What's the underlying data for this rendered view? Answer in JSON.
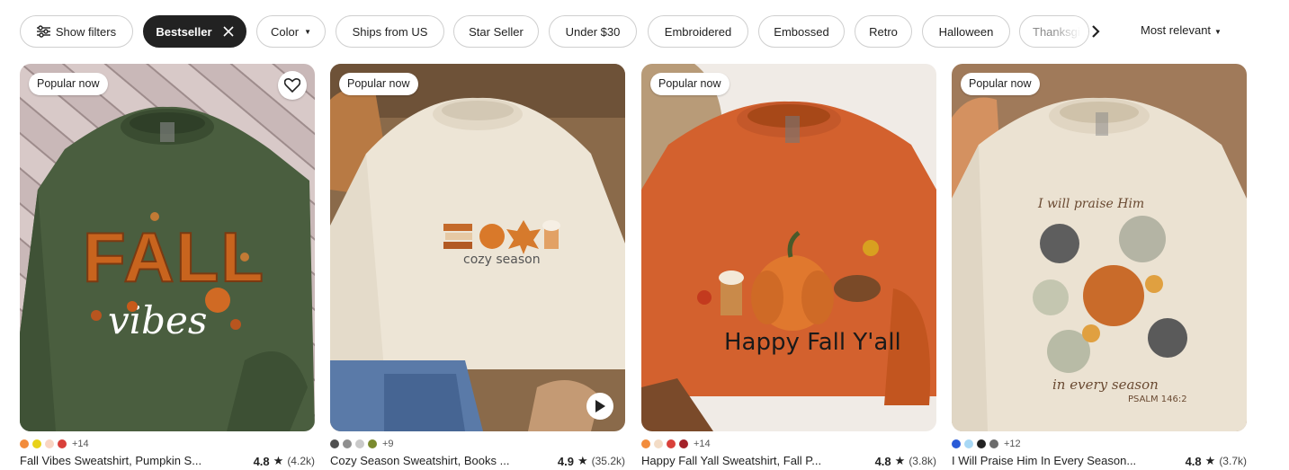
{
  "filters": {
    "show_filters": "Show filters",
    "chips": [
      "Bestseller",
      "Color",
      "Ships from US",
      "Star Seller",
      "Under $30",
      "Embroidered",
      "Embossed",
      "Retro",
      "Halloween",
      "Thanksgi"
    ],
    "sort": "Most relevant"
  },
  "products": [
    {
      "badge": "Popular now",
      "title": "Fall Vibes Sweatshirt, Pumpkin S...",
      "rating": "4.8",
      "reviews": "(4.2k)",
      "swatches": [
        "#f28c3c",
        "#e8d21a",
        "#f9d5c3",
        "#d9403a"
      ],
      "more_colors": "+14",
      "shirt_color": "#4a5e3f",
      "graphic_text": [
        "FALL",
        "vibes"
      ]
    },
    {
      "badge": "Popular now",
      "title": "Cozy Season Sweatshirt, Books ...",
      "rating": "4.9",
      "reviews": "(35.2k)",
      "swatches": [
        "#4f4f4f",
        "#8f8f8f",
        "#c9c9c9",
        "#7a8a2e"
      ],
      "more_colors": "+9",
      "shirt_color": "#ede5d6",
      "graphic_text": [
        "cozy season"
      ]
    },
    {
      "badge": "Popular now",
      "title": "Happy Fall Yall Sweatshirt, Fall P...",
      "rating": "4.8",
      "reviews": "(3.8k)",
      "swatches": [
        "#f28c3c",
        "#f3dcc6",
        "#d9403a",
        "#a3222a"
      ],
      "more_colors": "+14",
      "shirt_color": "#d3612e",
      "graphic_text": [
        "Happy Fall Y'all"
      ]
    },
    {
      "badge": "Popular now",
      "title": "I Will Praise Him In Every Season...",
      "rating": "4.8",
      "reviews": "(3.7k)",
      "swatches": [
        "#2a5bd7",
        "#a8d8f5",
        "#222222",
        "#6b6b6b"
      ],
      "more_colors": "+12",
      "shirt_color": "#ebe2d2",
      "graphic_text": [
        "I will praise Him",
        "in every season",
        "PSALM 146:2"
      ]
    }
  ]
}
